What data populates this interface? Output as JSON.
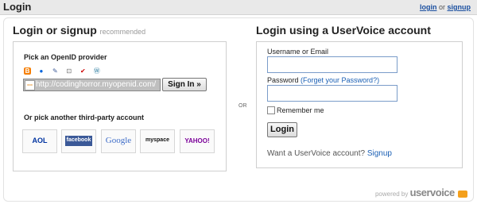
{
  "header": {
    "title": "Login",
    "login_link": "login",
    "or_text": "or",
    "signup_link": "signup"
  },
  "left": {
    "heading": "Login or signup",
    "heading_sub": "recommended",
    "pick_openid": "Pick an OpenID provider",
    "provider_icons": [
      "blogger-icon",
      "flickr-icon",
      "pen-icon",
      "lock-icon",
      "checkmark-icon",
      "wordpress-icon"
    ],
    "openid_url": "http://codinghorror.myopenid.com/",
    "signin_button": "Sign In »",
    "third_party_heading": "Or pick another third-party account",
    "third_party": [
      {
        "name": "AOL",
        "color": "#0033a0"
      },
      {
        "name": "facebook",
        "color": "#ffffff"
      },
      {
        "name": "Google",
        "color": "#3d6cc8"
      },
      {
        "name": "myspace",
        "color": "#111111"
      },
      {
        "name": "YAHOO!",
        "color": "#7b0099"
      }
    ]
  },
  "or_separator": "OR",
  "right": {
    "heading": "Login using a UserVoice account",
    "username_label": "Username or Email",
    "password_label": "Password",
    "forgot_link": "(Forget your Password?)",
    "remember_label": "Remember me",
    "login_button": "Login",
    "want_account": "Want a UserVoice account?",
    "signup_link": "Signup"
  },
  "footer": {
    "powered_by": "powered by",
    "brand": "uservoice"
  },
  "colors": {
    "link": "#1a5fb4",
    "input_border": "#7a9cc9",
    "topbar_bg": "#e9e9e9"
  }
}
